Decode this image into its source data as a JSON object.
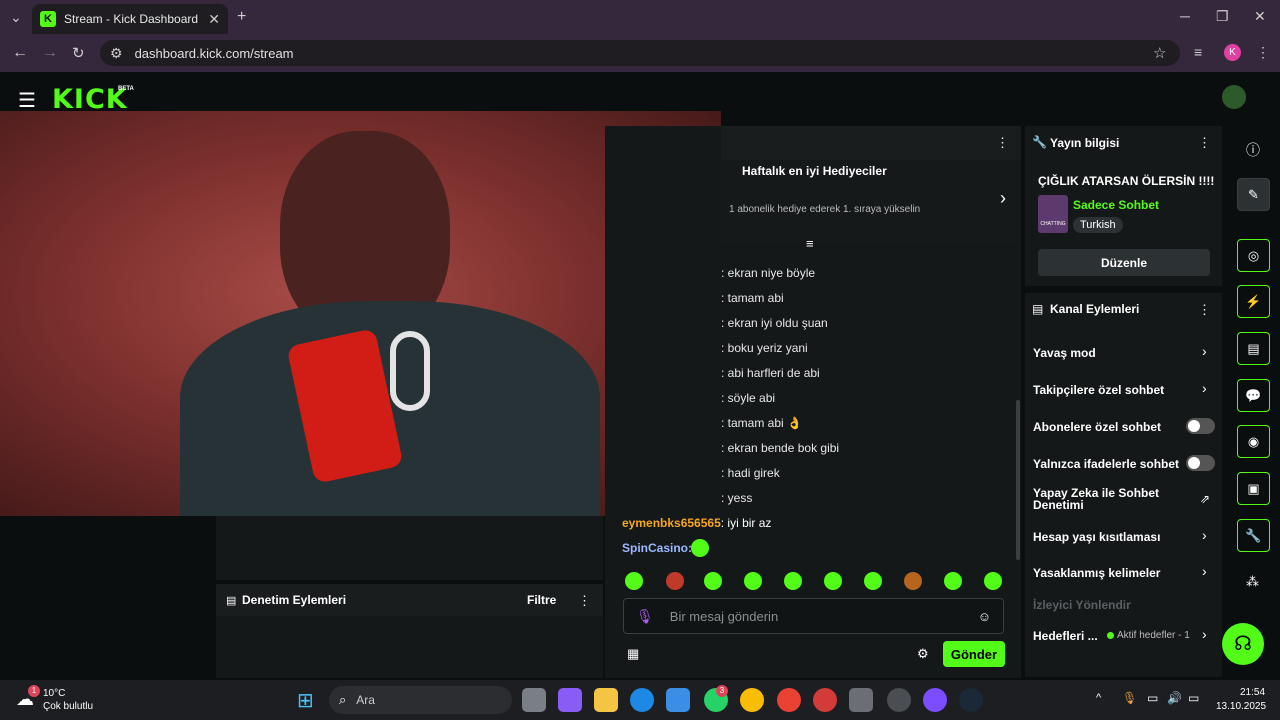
{
  "browser": {
    "tab_title": "Stream - Kick Dashboard",
    "url": "dashboard.kick.com/stream",
    "profile_initial": "K"
  },
  "app": {
    "logo": "KICK",
    "beta": "BETA"
  },
  "chat": {
    "gifters_title": "Haftalık en iyi Hediyeciler",
    "gifters_sub": "1 abonelik hediye ederek 1. sıraya yükselin",
    "messages": [
      {
        "text": ": ekran niye böyle"
      },
      {
        "text": ": tamam abi"
      },
      {
        "text": ": ekran iyi oldu şuan"
      },
      {
        "text": ": boku yeriz yani"
      },
      {
        "text": ": abi harfleri de abi"
      },
      {
        "text": ": söyle abi"
      },
      {
        "text": ": tamam abi 👌"
      },
      {
        "text": ": ekran bende bok gibi"
      },
      {
        "text": ": hadi girek"
      },
      {
        "text": ": yess"
      }
    ],
    "user_msg": {
      "user": "eymenbks656565",
      "text": ": iyi bir az"
    },
    "casino_user": "SpinCasino:",
    "input_placeholder": "Bir mesaj gönderin",
    "send": "Gönder"
  },
  "moderation": {
    "title": "Denetim Eylemleri",
    "filter": "Filtre"
  },
  "stream_info": {
    "title": "Yayın bilgisi",
    "stream_title": "ÇIĞLIK ATARSAN ÖLERSİN !!!!",
    "category": "Sadece Sohbet",
    "language": "Turkish",
    "thumb_text": "CHATTING",
    "edit": "Düzenle"
  },
  "channel_actions": {
    "title": "Kanal Eylemleri",
    "slow": "Yavaş mod",
    "followers": "Takipçilere özel sohbet",
    "subs": "Abonelere özel sohbet",
    "emotes": "Yalnızca ifadelerle sohbet",
    "ai": "Yapay Zeka ile Sohbet Denetimi",
    "age": "Hesap yaşı kısıtlaması",
    "banned": "Yasaklanmış kelimeler",
    "viewer_dir": "İzleyici Yönlendir",
    "goals": "Hedefleri ...",
    "goals_status": "Aktif hedefler - 1"
  },
  "taskbar": {
    "temp": "10°C",
    "weather": "Çok bulutlu",
    "search": "Ara",
    "time": "21:54",
    "date": "13.10.2025",
    "weather_badge": "1",
    "whatsapp_badge": "3"
  },
  "colors": {
    "accent": "#53fc18",
    "chrome": "#35283d"
  }
}
